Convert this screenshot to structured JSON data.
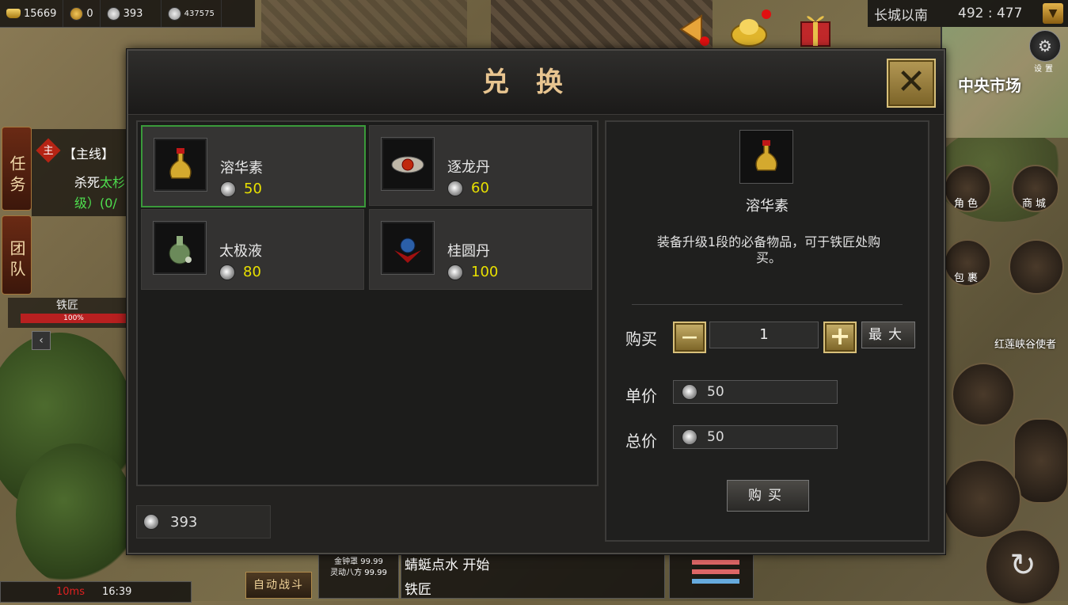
{
  "top_resources": {
    "ingot": "15669",
    "gold": "0",
    "silver": "393",
    "bound": "437575"
  },
  "location": {
    "name": "长城以南",
    "coords": "492 : 477"
  },
  "minimap": {
    "label": "中央市场",
    "settings": "设置"
  },
  "side_tabs": {
    "quest": "任务",
    "team": "团队"
  },
  "quest": {
    "badge": "主",
    "type": "【主线】",
    "line1": "杀死",
    "line1_green": "太杉",
    "line2": "级）(0/"
  },
  "npc_bar": {
    "name": "铁匠",
    "percent": "100%"
  },
  "right_buttons": {
    "role": "角色",
    "shop": "商城",
    "bag": "包裹",
    "npc": "红莲峡谷使者"
  },
  "dialog": {
    "title": "兑换",
    "items": [
      {
        "name": "溶华素",
        "price": "50"
      },
      {
        "name": "逐龙丹",
        "price": "60"
      },
      {
        "name": "太极液",
        "price": "80"
      },
      {
        "name": "桂圆丹",
        "price": "100"
      }
    ],
    "wallet": "393",
    "detail": {
      "name": "溶华素",
      "description": "装备升级1段的必备物品，可于铁匠处购买。",
      "buy_label": "购买",
      "minus": "—",
      "qty": "1",
      "plus": "+",
      "max": "最大",
      "unit_label": "单价",
      "unit_price": "50",
      "total_label": "总价",
      "total_price": "50",
      "purchase": "购买"
    }
  },
  "bottom": {
    "auto_fight": "自动战斗",
    "ping": "10ms",
    "time": "16:39",
    "chat1": "蜻蜓点水 开始",
    "chat2": "铁匠",
    "buffs": [
      "金钟罩 99.99",
      "灵动八方 99.99"
    ]
  }
}
